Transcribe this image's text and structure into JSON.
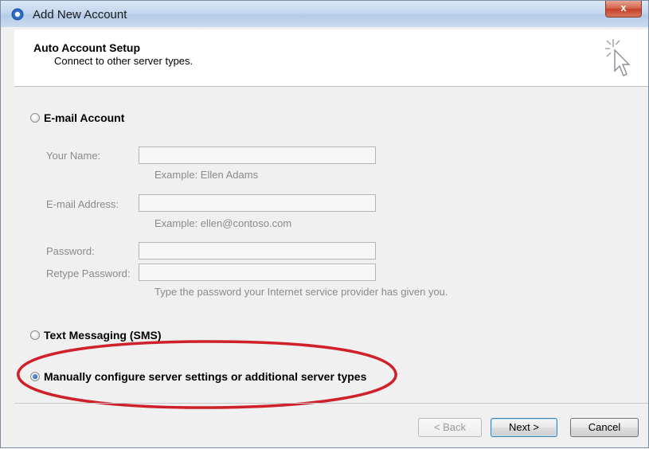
{
  "window": {
    "title": "Add New Account",
    "close_glyph": "x"
  },
  "header": {
    "title": "Auto Account Setup",
    "subtitle": "Connect to other server types."
  },
  "email_option": {
    "label": "E-mail Account",
    "your_name": {
      "label": "Your Name:",
      "value": "",
      "hint": "Example: Ellen Adams"
    },
    "email_address": {
      "label": "E-mail Address:",
      "value": "",
      "hint": "Example: ellen@contoso.com"
    },
    "password": {
      "label": "Password:",
      "value": ""
    },
    "retype_password": {
      "label": "Retype Password:",
      "value": ""
    },
    "password_hint": "Type the password your Internet service provider has given you."
  },
  "sms_option": {
    "label": "Text Messaging (SMS)"
  },
  "manual_option": {
    "label": "Manually configure server settings or additional server types",
    "selected": true
  },
  "buttons": {
    "back": "< Back",
    "next": "Next >",
    "cancel": "Cancel"
  },
  "colors": {
    "highlight_ellipse": "#d0202a",
    "accent": "#3c7fb1"
  },
  "icons": [
    "outlook-app-icon",
    "setup-cursor-icon",
    "radio-icon"
  ]
}
